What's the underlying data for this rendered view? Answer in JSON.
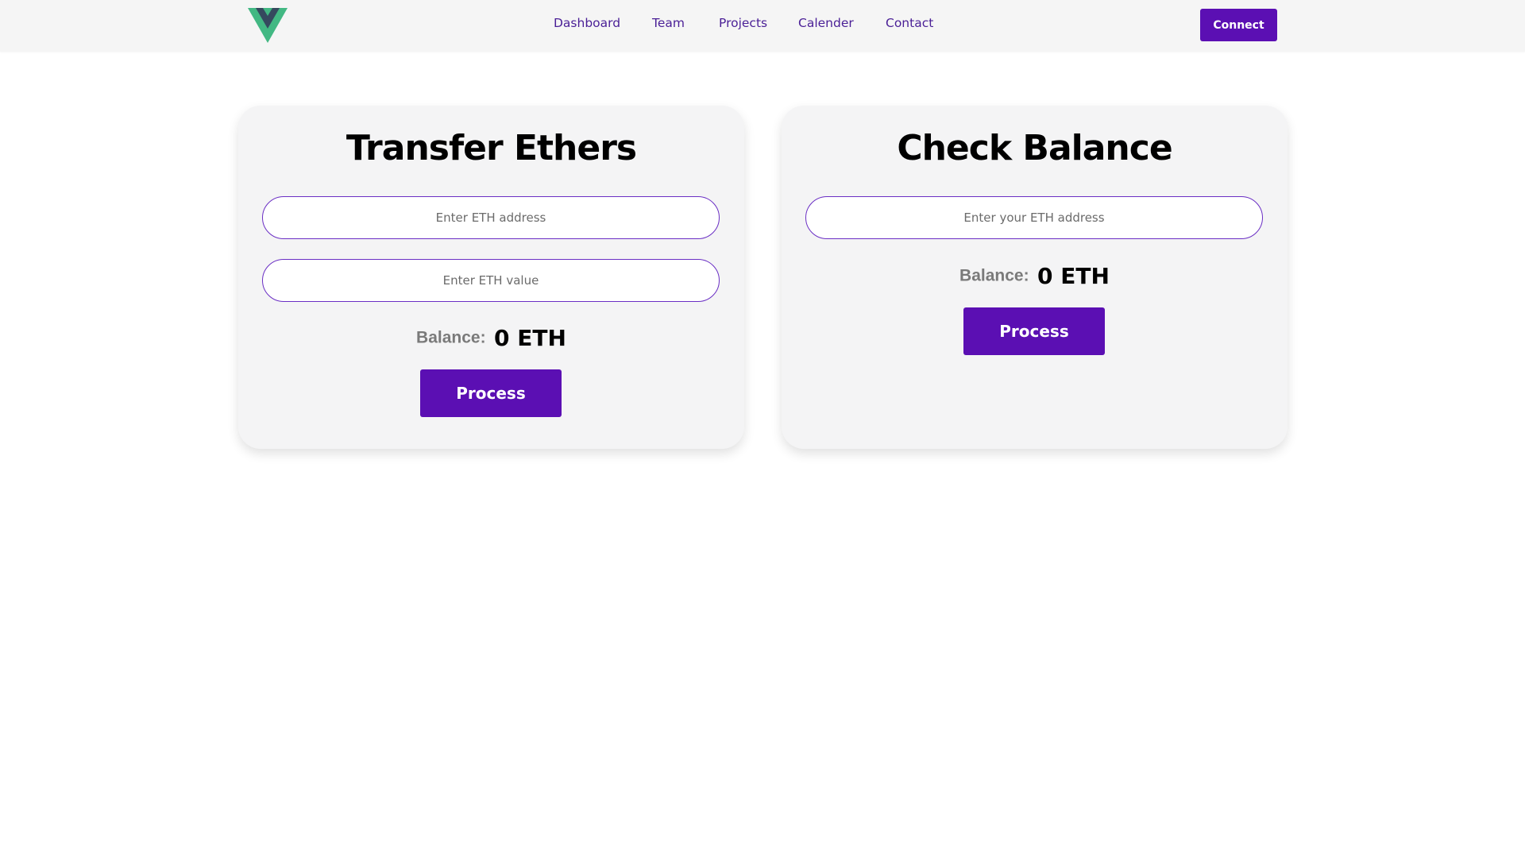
{
  "brand": {
    "logo_icon": "vue-logo-icon",
    "colors": {
      "logo_outer": "#42b883",
      "logo_inner": "#35495e",
      "accent": "#5b0fb3",
      "nav_text": "#4a1f96"
    }
  },
  "nav": {
    "links": [
      {
        "label": "Dashboard"
      },
      {
        "label": "Team"
      },
      {
        "label": "Projects"
      },
      {
        "label": "Calender"
      },
      {
        "label": "Contact"
      }
    ],
    "connect_label": "Connect"
  },
  "transfer": {
    "title": "Transfer Ethers",
    "address_placeholder": "Enter ETH address",
    "value_placeholder": "Enter ETH value",
    "balance_label": "Balance:",
    "balance_value": "0 ETH",
    "process_label": "Process"
  },
  "check": {
    "title": "Check Balance",
    "address_placeholder": "Enter your ETH address",
    "balance_label": "Balance:",
    "balance_value": "0 ETH",
    "process_label": "Process"
  }
}
